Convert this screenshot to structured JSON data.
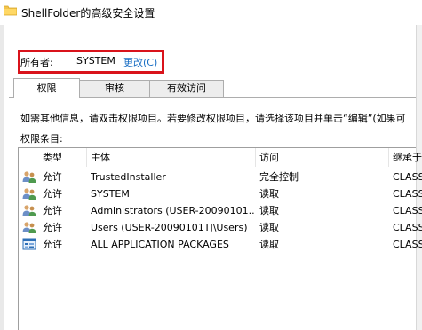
{
  "window": {
    "title": "ShellFolder的高级安全设置"
  },
  "owner": {
    "label": "所有者:",
    "value": "SYSTEM",
    "change_link": "更改(C)"
  },
  "tabs": [
    {
      "label": "权限",
      "active": true
    },
    {
      "label": "审核",
      "active": false
    },
    {
      "label": "有效访问",
      "active": false
    }
  ],
  "instructions": "如需其他信息，请双击权限项目。若要修改权限项目，请选择该项目并单击“编辑”(如果可",
  "entries_label": "权限条目:",
  "table": {
    "headers": [
      "类型",
      "主体",
      "访问",
      "继承于"
    ],
    "rows": [
      {
        "type": "允许",
        "principal": "TrustedInstaller",
        "access": "完全控制",
        "inherited": "CLASS",
        "icon": "users-icon"
      },
      {
        "type": "允许",
        "principal": "SYSTEM",
        "access": "读取",
        "inherited": "CLASS",
        "icon": "users-icon"
      },
      {
        "type": "允许",
        "principal": "Administrators (USER-20090101...",
        "access": "读取",
        "inherited": "CLASS",
        "icon": "users-icon"
      },
      {
        "type": "允许",
        "principal": "Users (USER-20090101TJ\\Users)",
        "access": "读取",
        "inherited": "CLASS",
        "icon": "users-icon"
      },
      {
        "type": "允许",
        "principal": "ALL APPLICATION PACKAGES",
        "access": "读取",
        "inherited": "CLASS",
        "icon": "app-packages-icon"
      }
    ]
  },
  "colors": {
    "highlight_border": "#d9131b",
    "link": "#1a6fc4"
  }
}
